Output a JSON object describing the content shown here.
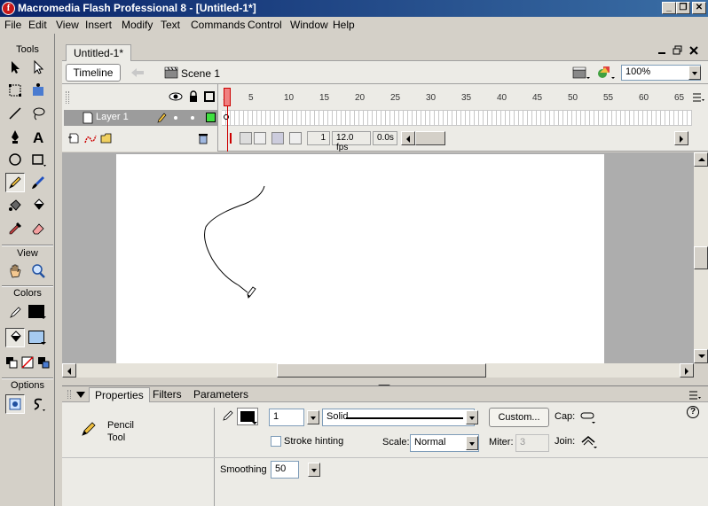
{
  "window": {
    "app_icon_letter": "f",
    "title": "Macromedia Flash Professional 8 - [Untitled-1*]",
    "minimize": "_",
    "restore": "❐",
    "close": "✕"
  },
  "menu": [
    "File",
    "Edit",
    "View",
    "Insert",
    "Modify",
    "Text",
    "Commands",
    "Control",
    "Window",
    "Help"
  ],
  "tools": {
    "header": "Tools",
    "view_header": "View",
    "colors_header": "Colors",
    "options_header": "Options",
    "stroke_color": "#000000",
    "fill_color": "#a6caf0",
    "selected_tool": "pencil-tool"
  },
  "document": {
    "tab_title": "Untitled-1*",
    "timeline_button": "Timeline",
    "scene_label": "Scene 1",
    "zoom": "100%"
  },
  "timeline": {
    "layer_name": "Layer 1",
    "frame_numbers": [
      "1",
      "5",
      "10",
      "15",
      "20",
      "25",
      "30",
      "35",
      "40",
      "45",
      "50",
      "55",
      "60",
      "65"
    ],
    "current_frame": "1",
    "fps": "12.0 fps",
    "elapsed": "0.0s"
  },
  "properties": {
    "tabs": [
      "Properties",
      "Filters",
      "Parameters"
    ],
    "tool_name_line1": "Pencil",
    "tool_name_line2": "Tool",
    "stroke_height": "1",
    "stroke_style": "Solid",
    "custom_button": "Custom...",
    "cap_label": "Cap:",
    "stroke_hinting_label": "Stroke hinting",
    "scale_label": "Scale:",
    "scale_value": "Normal",
    "miter_label": "Miter:",
    "miter_value": "3",
    "join_label": "Join:",
    "smoothing_label": "Smoothing",
    "smoothing_value": "50",
    "help_glyph": "?"
  }
}
